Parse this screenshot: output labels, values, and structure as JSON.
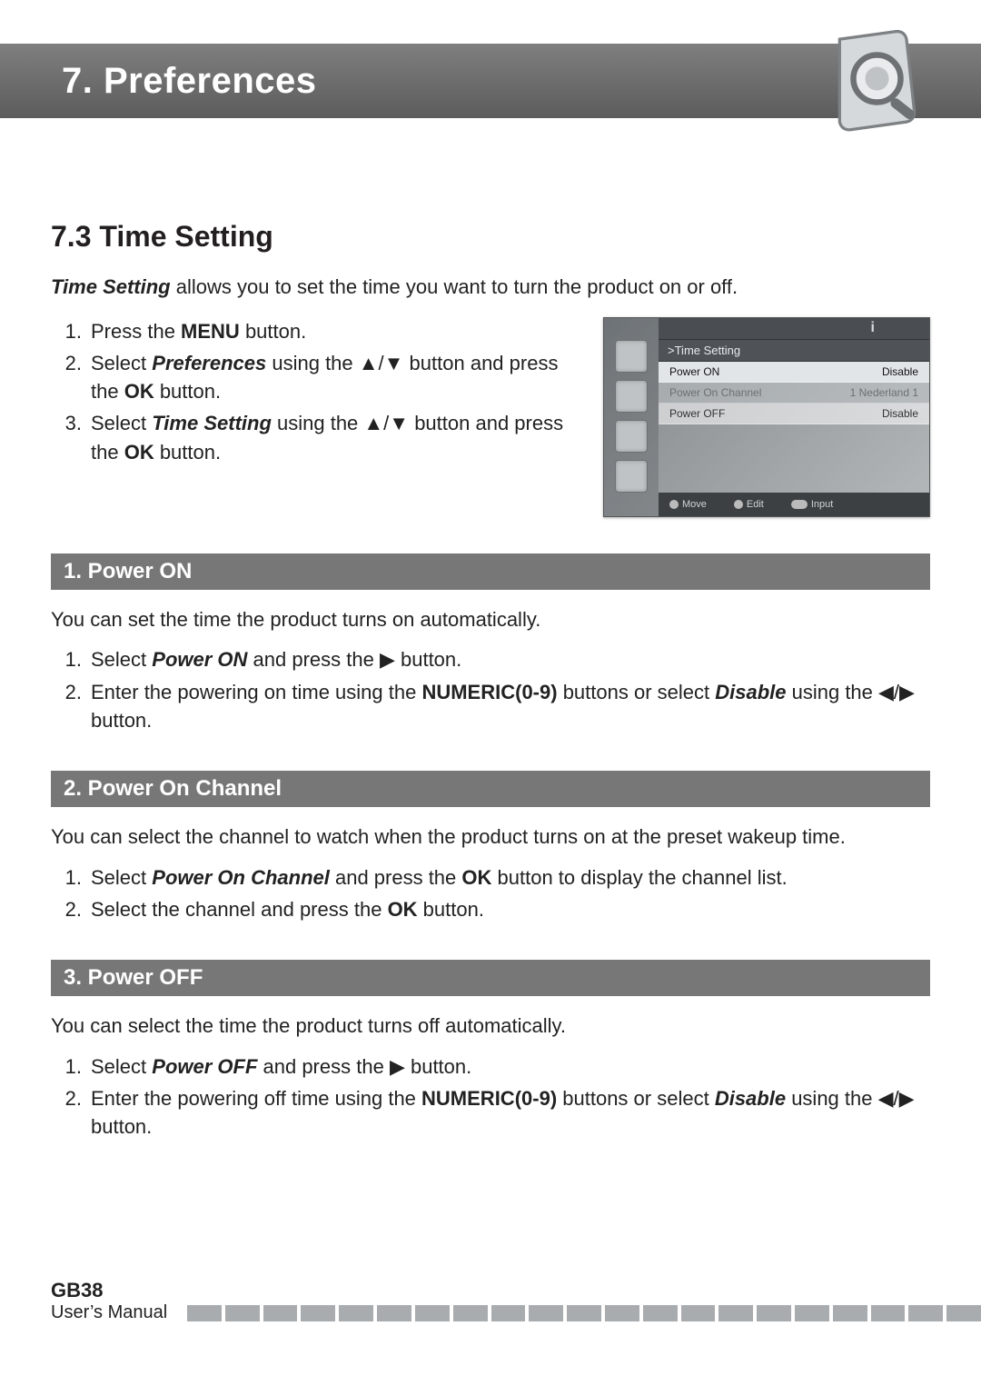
{
  "chapter_title": "7. Preferences",
  "section_title": "7.3 Time Setting",
  "intro": {
    "lead": "Time Setting",
    "rest": " allows you to set the time you want to turn the product on or off."
  },
  "main_steps": {
    "s1": {
      "a": "Press the ",
      "b": "MENU",
      "c": " button."
    },
    "s2": {
      "a": "Select ",
      "b": "Preferences",
      "c": " using the ",
      "arrows": "▲/▼",
      "d": " button and press the ",
      "ok": "OK",
      "e": " button."
    },
    "s3": {
      "a": "Select ",
      "b": "Time Setting",
      "c": " using the ",
      "arrows": "▲/▼",
      "d": " button and press the ",
      "ok": "OK",
      "e": " button."
    }
  },
  "tv": {
    "breadcrumb": ">Time Setting",
    "i_mark": "i",
    "rows": {
      "r1": {
        "label": "Power ON",
        "value": "Disable"
      },
      "r2": {
        "label": "Power On Channel",
        "value": "1 Nederland 1"
      },
      "r3": {
        "label": "Power OFF",
        "value": "Disable"
      }
    },
    "hints": {
      "move": "Move",
      "edit": "Edit",
      "input": "Input"
    }
  },
  "sub1": {
    "title": "1. Power ON",
    "desc": "You can set the time the product turns on automatically.",
    "s1": {
      "a": "Select ",
      "b": "Power ON",
      "c": " and press the ",
      "arrow": "▶",
      "d": " button."
    },
    "s2": {
      "a": "Enter the powering on time using the ",
      "b": "NUMERIC(0-9)",
      "c": " buttons or select ",
      "d": "Disable",
      "e": " using the ",
      "arrows": "◀/▶",
      "f": " button."
    }
  },
  "sub2": {
    "title": "2. Power On Channel",
    "desc": "You can select the channel to watch when the product turns on at the preset wakeup time.",
    "s1": {
      "a": "Select ",
      "b": "Power On Channel",
      "c": " and press the ",
      "ok": "OK",
      "d": " button to display the channel list."
    },
    "s2": {
      "a": "Select the channel and press the ",
      "ok": "OK",
      "b": " button."
    }
  },
  "sub3": {
    "title": "3. Power OFF",
    "desc": "You can select the time the product turns off automatically.",
    "s1": {
      "a": "Select ",
      "b": "Power OFF",
      "c": " and press the ",
      "arrow": "▶",
      "d": " button."
    },
    "s2": {
      "a": "Enter the powering off time using the ",
      "b": "NUMERIC(0-9)",
      "c": " buttons or select ",
      "d": "Disable",
      "e": " using the ",
      "arrows": "◀/▶",
      "f": " button."
    }
  },
  "footer": {
    "page": "GB38",
    "doc": "User’s Manual"
  }
}
